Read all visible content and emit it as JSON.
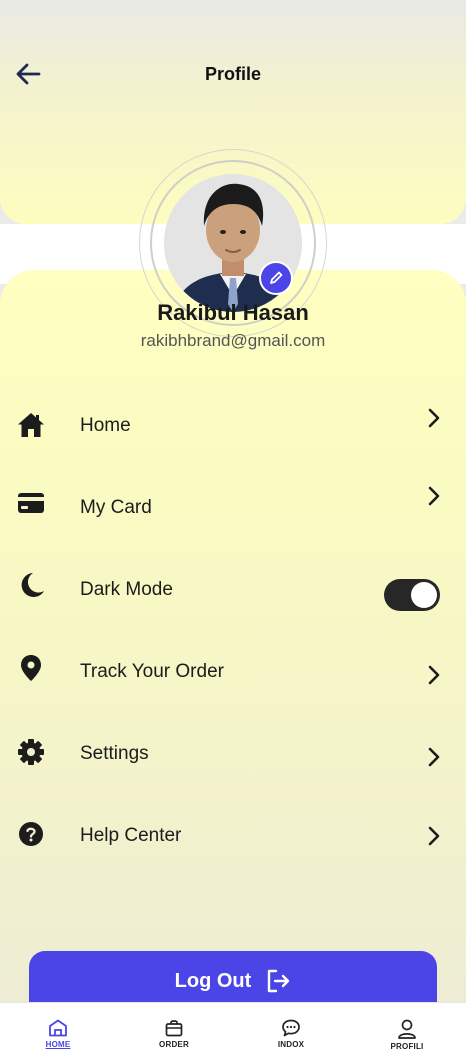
{
  "header": {
    "title": "Profile",
    "back_icon": "arrow-left-icon"
  },
  "profile": {
    "name": "Rakibul Hasan",
    "email": "rakibhbrand@gmail.com",
    "edit_icon": "pencil-icon"
  },
  "menu": [
    {
      "label": "Home",
      "icon": "house-icon",
      "action": "chevron"
    },
    {
      "label": "My Card",
      "icon": "credit-card-icon",
      "action": "chevron"
    },
    {
      "label": "Dark Mode",
      "icon": "moon-icon",
      "action": "toggle",
      "toggle_on": true
    },
    {
      "label": "Track Your Order",
      "icon": "location-pin-icon",
      "action": "chevron"
    },
    {
      "label": "Settings",
      "icon": "gear-icon",
      "action": "chevron"
    },
    {
      "label": "Help Center",
      "icon": "question-circle-icon",
      "action": "chevron"
    }
  ],
  "logout": {
    "label": "Log Out",
    "icon": "logout-icon"
  },
  "bottom_nav": [
    {
      "label": "HOME",
      "icon": "home-icon",
      "active": true
    },
    {
      "label": "ORDER",
      "icon": "shopping-bag-icon",
      "active": false
    },
    {
      "label": "INDOX",
      "icon": "chat-bubble-icon",
      "active": false
    },
    {
      "label": "PROFILI",
      "icon": "user-icon",
      "active": false
    }
  ],
  "colors": {
    "accent": "#4b44e6",
    "toggle_track": "#272727",
    "header_bg": "#fdfdc0"
  }
}
